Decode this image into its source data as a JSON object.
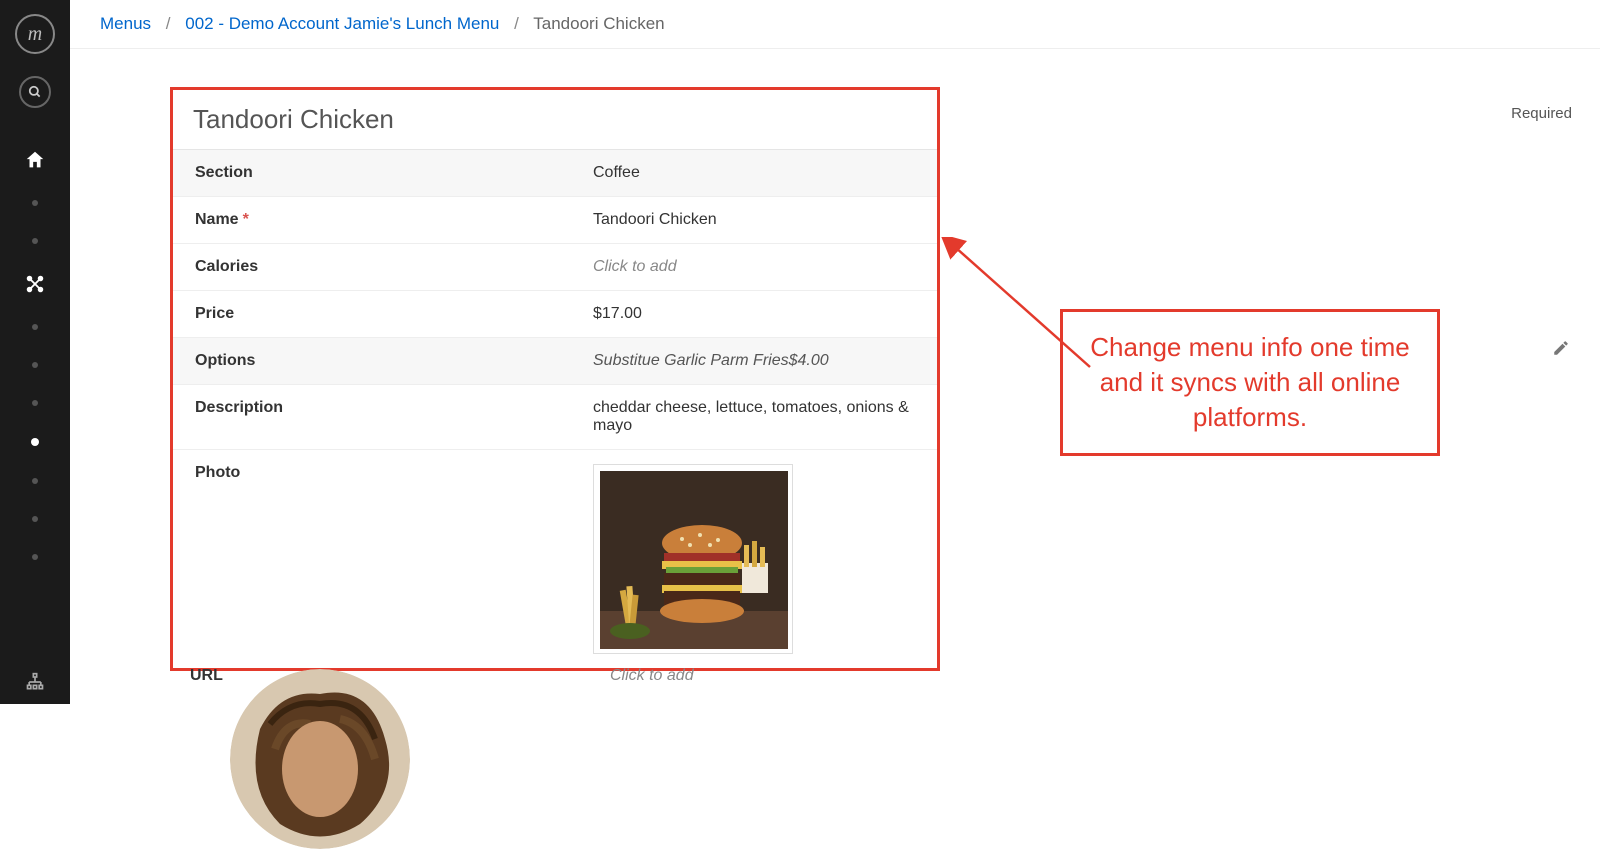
{
  "breadcrumb": {
    "root": "Menus",
    "middle": "002 - Demo Account Jamie's Lunch Menu",
    "current": "Tandoori Chicken"
  },
  "header": {
    "required_label": "Required"
  },
  "panel": {
    "title": "Tandoori Chicken",
    "rows": {
      "section": {
        "label": "Section",
        "value": "Coffee"
      },
      "name": {
        "label": "Name",
        "value": "Tandoori Chicken",
        "required": true
      },
      "calories": {
        "label": "Calories",
        "placeholder": "Click to add"
      },
      "price": {
        "label": "Price",
        "value": "$17.00"
      },
      "options": {
        "label": "Options",
        "value": "Substitue Garlic Parm Fries$4.00"
      },
      "description": {
        "label": "Description",
        "value": "cheddar cheese, lettuce, tomatoes, onions & mayo"
      },
      "photo": {
        "label": "Photo"
      },
      "url": {
        "label": "URL",
        "placeholder": "Click to add"
      }
    }
  },
  "callout": {
    "text": "Change menu info one time and it syncs with all online platforms."
  },
  "icons": {
    "logo": "m",
    "search": "search-icon",
    "home": "home-icon",
    "network": "network-icon",
    "org": "org-icon",
    "pencil": "pencil-icon"
  }
}
